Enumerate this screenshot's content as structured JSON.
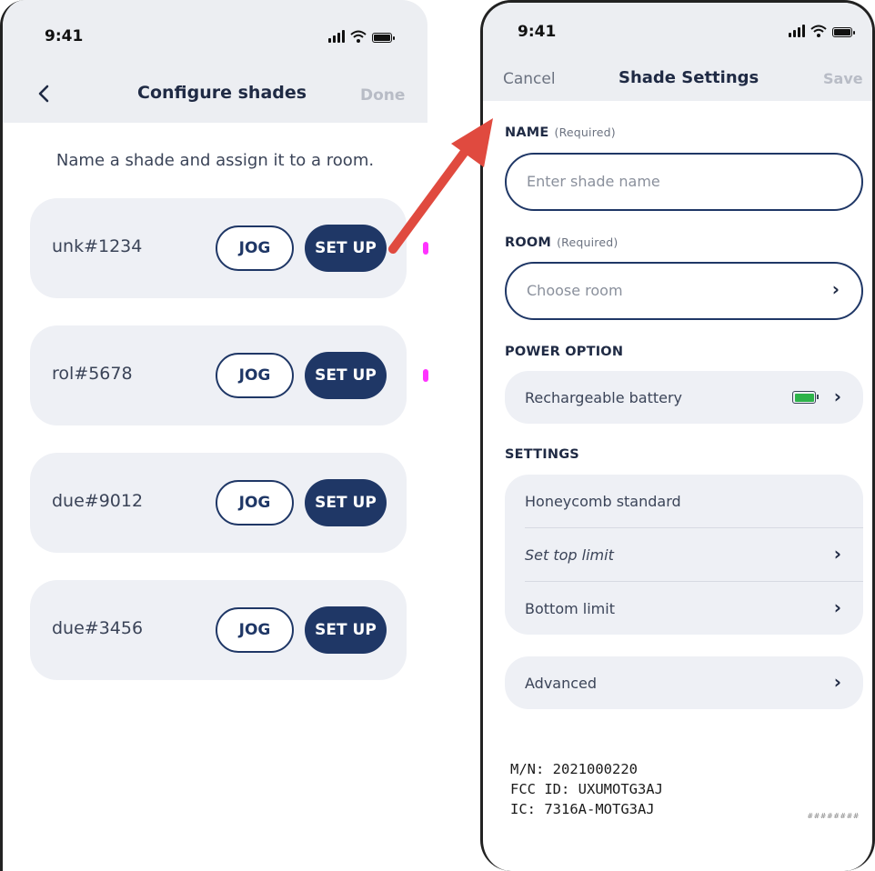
{
  "left": {
    "status_time": "9:41",
    "nav": {
      "title": "Configure shades",
      "done_label": "Done"
    },
    "subtitle": "Name a shade and assign it to a room.",
    "shades": [
      {
        "name": "unk#1234",
        "jog_label": "JOG",
        "setup_label": "SET UP"
      },
      {
        "name": "rol#5678",
        "jog_label": "JOG",
        "setup_label": "SET UP"
      },
      {
        "name": "due#9012",
        "jog_label": "JOG",
        "setup_label": "SET UP"
      },
      {
        "name": "due#3456",
        "jog_label": "JOG",
        "setup_label": "SET UP"
      }
    ]
  },
  "right": {
    "status_time": "9:41",
    "nav": {
      "cancel_label": "Cancel",
      "title": "Shade Settings",
      "save_label": "Save"
    },
    "name_section": {
      "label": "NAME",
      "required": "(Required)",
      "placeholder": "Enter shade name"
    },
    "room_section": {
      "label": "ROOM",
      "required": "(Required)",
      "placeholder": "Choose room"
    },
    "power_section": {
      "label": "POWER OPTION",
      "value": "Rechargeable battery"
    },
    "settings_section": {
      "label": "SETTINGS",
      "rows": [
        "Honeycomb standard",
        "Set top limit",
        "Bottom limit"
      ]
    },
    "advanced_label": "Advanced",
    "device_info": [
      "M/N: 2021000220",
      "FCC ID: UXUMOTG3AJ",
      "IC: 7316A-MOTG3AJ"
    ],
    "hash_note": "########"
  },
  "colors": {
    "primary": "#1f3766",
    "card_bg": "#eef0f5",
    "battery": "#2db34a",
    "arrow": "#e04a3f"
  }
}
